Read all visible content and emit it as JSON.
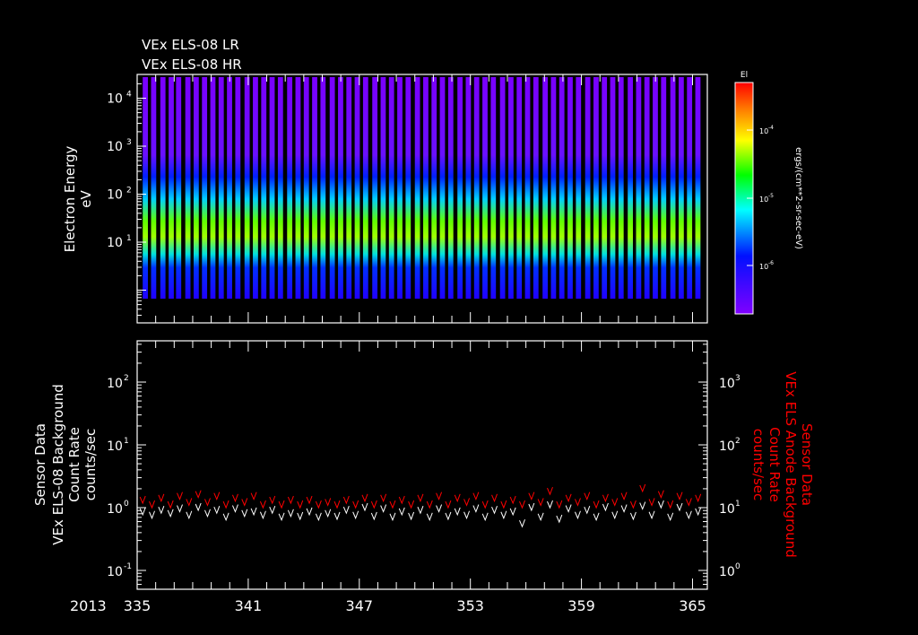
{
  "chart_data": [
    {
      "type": "heatmap",
      "titles": [
        "VEx ELS-08 LR",
        "VEx ELS-08 HR"
      ],
      "ylabel": [
        "Electron Energy",
        "eV"
      ],
      "yscale": "log",
      "ylim": [
        0.1,
        30000
      ],
      "yticks": [
        {
          "v": 10,
          "label": "10",
          "exp": "1"
        },
        {
          "v": 100,
          "label": "10",
          "exp": "2"
        },
        {
          "v": 1000,
          "label": "10",
          "exp": "3"
        },
        {
          "v": 10000,
          "label": "10",
          "exp": "4"
        }
      ],
      "xlim": [
        335,
        365.8
      ],
      "pass_start_days": [
        335.3,
        335.75,
        336.25,
        336.7,
        337.1,
        337.6,
        338.05,
        338.5,
        338.95,
        339.4,
        339.85,
        340.3,
        340.8,
        341.25,
        341.7,
        342.15,
        342.6,
        343.1,
        343.55,
        344.0,
        344.45,
        344.9,
        345.4,
        345.85,
        346.3,
        346.75,
        347.2,
        347.7,
        348.15,
        348.6,
        349.05,
        349.5,
        350.0,
        350.45,
        350.9,
        351.35,
        351.8,
        352.3,
        352.75,
        353.2,
        353.65,
        354.1,
        354.6,
        355.05,
        355.5,
        355.95,
        356.4,
        356.9,
        357.35,
        357.8,
        358.25,
        358.7,
        359.2,
        359.65,
        360.1,
        360.55,
        361.0,
        361.5,
        361.95,
        362.4,
        362.85,
        363.3,
        363.8,
        364.25,
        364.7,
        365.15
      ],
      "pass_duration_days": 0.28,
      "colorbar": {
        "title": "El",
        "label": "ergs/(cm**2-sr-sec-eV)",
        "scale": "log",
        "range": [
          2e-07,
          0.0004
        ],
        "ticks": [
          {
            "label": "10",
            "exp": "-4"
          },
          {
            "label": "10",
            "exp": "-5"
          },
          {
            "label": "10",
            "exp": "-6"
          }
        ]
      }
    },
    {
      "type": "line",
      "ylabel_left": [
        "Sensor Data",
        "VEx ELS-08 Background",
        "Count Rate",
        "counts/sec"
      ],
      "ylabel_right": [
        "Sensor Data",
        "VEx ELS Anode Background",
        "Count Rate",
        "counts/sec"
      ],
      "yscale": "log",
      "ylim_left": [
        0.05,
        500
      ],
      "ylim_right": [
        0.5,
        5000
      ],
      "yticks_left": [
        {
          "label": "10",
          "exp": "-1"
        },
        {
          "label": "10",
          "exp": "0"
        },
        {
          "label": "10",
          "exp": "1"
        },
        {
          "label": "10",
          "exp": "2"
        }
      ],
      "yticks_right": [
        {
          "label": "10",
          "exp": "0"
        },
        {
          "label": "10",
          "exp": "1"
        },
        {
          "label": "10",
          "exp": "2"
        },
        {
          "label": "10",
          "exp": "3"
        }
      ],
      "xlabel_year": "2013",
      "xticks": [
        "335",
        "341",
        "347",
        "353",
        "359",
        "365"
      ],
      "xlim": [
        335,
        365.8
      ],
      "series": [
        {
          "name": "VEx ELS-08 Background",
          "color": "#ffffff",
          "axis": "left",
          "x": [
            335.3,
            335.8,
            336.3,
            336.8,
            337.3,
            337.8,
            338.3,
            338.8,
            339.3,
            339.8,
            340.3,
            340.8,
            341.3,
            341.8,
            342.3,
            342.8,
            343.3,
            343.8,
            344.3,
            344.8,
            345.3,
            345.8,
            346.3,
            346.8,
            347.3,
            347.8,
            348.3,
            348.8,
            349.3,
            349.8,
            350.3,
            350.8,
            351.3,
            351.8,
            352.3,
            352.8,
            353.3,
            353.8,
            354.3,
            354.8,
            355.3,
            355.8,
            356.3,
            356.8,
            357.3,
            357.8,
            358.3,
            358.8,
            359.3,
            359.8,
            360.3,
            360.8,
            361.3,
            361.8,
            362.3,
            362.8,
            363.3,
            363.8,
            364.3,
            364.8,
            365.3
          ],
          "y": [
            0.85,
            0.75,
            0.9,
            0.8,
            0.95,
            0.75,
            1.0,
            0.8,
            0.9,
            0.7,
            0.95,
            0.8,
            0.85,
            0.75,
            0.9,
            0.7,
            0.8,
            0.72,
            0.85,
            0.7,
            0.8,
            0.72,
            0.9,
            0.75,
            1.0,
            0.72,
            0.95,
            0.7,
            0.85,
            0.72,
            0.9,
            0.7,
            0.95,
            0.72,
            0.85,
            0.75,
            0.95,
            0.7,
            0.9,
            0.75,
            0.85,
            0.55,
            1.0,
            0.7,
            1.1,
            0.65,
            0.95,
            0.75,
            0.9,
            0.7,
            1.0,
            0.75,
            0.95,
            0.72,
            1.05,
            0.75,
            1.1,
            0.7,
            1.0,
            0.75,
            0.85
          ]
        },
        {
          "name": "VEx ELS Anode Background",
          "color": "#ff0000",
          "axis": "right",
          "x": [
            335.3,
            335.8,
            336.3,
            336.8,
            337.3,
            337.8,
            338.3,
            338.8,
            339.3,
            339.8,
            340.3,
            340.8,
            341.3,
            341.8,
            342.3,
            342.8,
            343.3,
            343.8,
            344.3,
            344.8,
            345.3,
            345.8,
            346.3,
            346.8,
            347.3,
            347.8,
            348.3,
            348.8,
            349.3,
            349.8,
            350.3,
            350.8,
            351.3,
            351.8,
            352.3,
            352.8,
            353.3,
            353.8,
            354.3,
            354.8,
            355.3,
            355.8,
            356.3,
            356.8,
            357.3,
            357.8,
            358.3,
            358.8,
            359.3,
            359.8,
            360.3,
            360.8,
            361.3,
            361.8,
            362.3,
            362.8,
            363.3,
            363.8,
            364.3,
            364.8,
            365.3
          ],
          "y": [
            13,
            11,
            14,
            11,
            15,
            12,
            16,
            12,
            15,
            11,
            14,
            12,
            15,
            11,
            13,
            11,
            13,
            11,
            13,
            11,
            12,
            11,
            13,
            11,
            14,
            11,
            14,
            11,
            13,
            11,
            14,
            11,
            15,
            11,
            14,
            12,
            15,
            11,
            14,
            11,
            13,
            11,
            15,
            12,
            18,
            11,
            14,
            12,
            15,
            11,
            14,
            12,
            15,
            11,
            20,
            12,
            16,
            11,
            15,
            12,
            14
          ]
        }
      ]
    }
  ]
}
